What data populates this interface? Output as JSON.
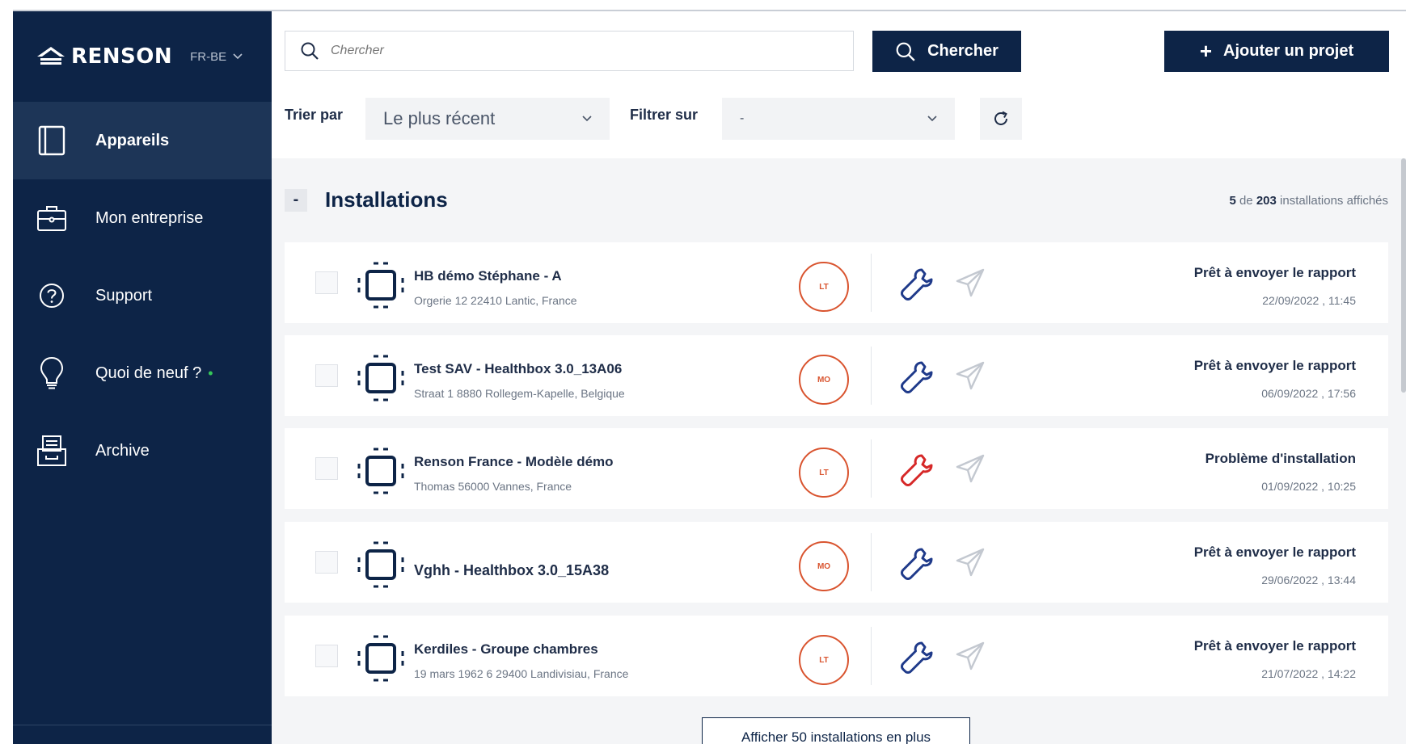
{
  "brand": {
    "name": "RENSON",
    "language": "FR-BE"
  },
  "sidebar": {
    "items": [
      {
        "label": "Appareils",
        "icon": "tablet-icon",
        "active": true
      },
      {
        "label": "Mon entreprise",
        "icon": "briefcase-icon",
        "active": false
      },
      {
        "label": "Support",
        "icon": "help-circle-icon",
        "active": false
      },
      {
        "label": "Quoi de neuf ?",
        "icon": "lightbulb-icon",
        "active": false,
        "dot": "•"
      },
      {
        "label": "Archive",
        "icon": "archive-icon",
        "active": false
      }
    ]
  },
  "search": {
    "placeholder": "Chercher",
    "button_label": "Chercher"
  },
  "add_project_label": "Ajouter un projet",
  "add_symbol": "+",
  "sort": {
    "label": "Trier par",
    "value": "Le plus récent"
  },
  "filter": {
    "label": "Filtrer sur",
    "value": "-"
  },
  "section": {
    "collapse_symbol": "-",
    "title": "Installations",
    "count_shown": "5",
    "count_text_de": "de",
    "count_total": "203",
    "count_suffix": "installations affichés"
  },
  "installations": [
    {
      "name": "HB démo Stéphane - A",
      "address": "Orgerie 12 22410 Lantic, France",
      "badge": "LT",
      "wrench_color": "#1f3a8a",
      "status": "Prêt à envoyer le rapport",
      "date": "22/09/2022 , 11:45"
    },
    {
      "name": "Test SAV - Healthbox 3.0_13A06",
      "address": "Straat 1 8880 Rollegem-Kapelle, Belgique",
      "badge": "MO",
      "wrench_color": "#1f3a8a",
      "status": "Prêt à envoyer le rapport",
      "date": "06/09/2022 , 17:56"
    },
    {
      "name": "Renson France - Modèle démo",
      "address": "Thomas 56000 Vannes, France",
      "badge": "LT",
      "wrench_color": "#d62828",
      "status": "Problème d'installation",
      "date": "01/09/2022 , 10:25"
    },
    {
      "name": "Vghh - Healthbox 3.0_15A38",
      "address": "",
      "badge": "MO",
      "wrench_color": "#1f3a8a",
      "status": "Prêt à envoyer le rapport",
      "date": "29/06/2022 , 13:44"
    },
    {
      "name": "Kerdiles - Groupe chambres",
      "address": "19 mars 1962 6 29400 Landivisiau, France",
      "badge": "LT",
      "wrench_color": "#1f3a8a",
      "status": "Prêt à envoyer le rapport",
      "date": "21/07/2022 , 14:22"
    }
  ],
  "more_button_label": "Afficher 50 installations en plus",
  "colors": {
    "navy": "#0d2447",
    "accent_red": "#d62828",
    "badge_orange": "#d9542f",
    "green_dot": "#35c759"
  }
}
